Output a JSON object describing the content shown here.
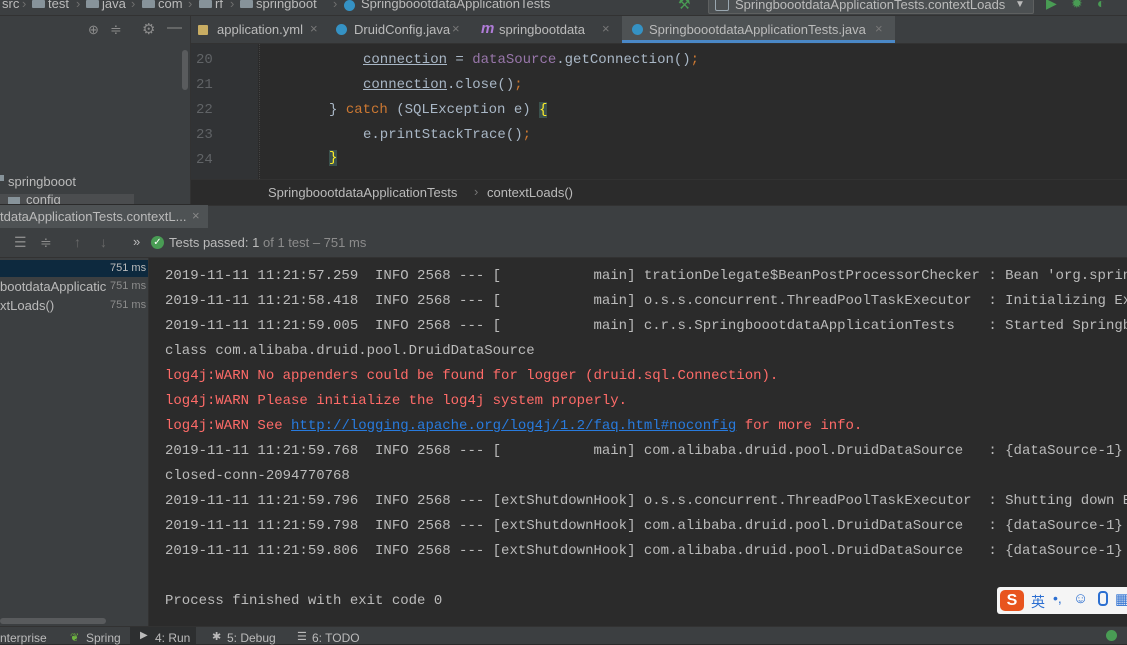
{
  "breadcrumb": [
    "src",
    "test",
    "java",
    "com",
    "rf",
    "springboot",
    "SpringboootdataApplicationTests"
  ],
  "run_config": {
    "label": "SpringboootdataApplicationTests.contextLoads"
  },
  "editor_tabs": [
    {
      "label": "application.yml",
      "active": false
    },
    {
      "label": "DruidConfig.java",
      "active": false
    },
    {
      "label": "springbootdata",
      "active": false
    },
    {
      "label": "SpringboootdataApplicationTests.java",
      "active": true
    }
  ],
  "project_tree": {
    "item1": "springbooot",
    "item2": "config"
  },
  "code": {
    "line_numbers": [
      "20",
      "21",
      "22",
      "23",
      "24"
    ],
    "l20_a": "connection",
    "l20_b": " = ",
    "l20_c": "dataSource",
    "l20_d": ".getConnection()",
    "l20_e": ";",
    "l21_a": "connection",
    "l21_b": ".close()",
    "l21_c": ";",
    "l22_a": "} ",
    "l22_b": "catch",
    "l22_c": " (SQLException e) ",
    "l22_d": "{",
    "l23_a": "e.printStackTrace()",
    "l23_b": ";",
    "l24_a": "}"
  },
  "editor_breadcrumb": {
    "class_name": "SpringboootdataApplicationTests",
    "method": "contextLoads()"
  },
  "run_tab": {
    "label": "tdataApplicationTests.contextL..."
  },
  "test_status": {
    "prefix": "Tests passed:",
    "count": "1",
    "suffix": "of 1 test – 751 ms"
  },
  "test_tree": [
    {
      "label": "",
      "time": "751 ms"
    },
    {
      "label": "bootdataApplicatic",
      "time": "751 ms"
    },
    {
      "label": "xtLoads()",
      "time": "751 ms"
    }
  ],
  "console": {
    "lines": [
      {
        "text": "2019-11-11 11:21:57.259  INFO 2568 --- [           main] trationDelegate$BeanPostProcessorChecker : Bean 'org.springfram",
        "type": "info"
      },
      {
        "text": "2019-11-11 11:21:58.418  INFO 2568 --- [           main] o.s.s.concurrent.ThreadPoolTaskExecutor  : Initializing Executo",
        "type": "info"
      },
      {
        "text": "2019-11-11 11:21:59.005  INFO 2568 --- [           main] c.r.s.SpringboootdataApplicationTests    : Started Springboootd",
        "type": "info"
      },
      {
        "text": "class com.alibaba.druid.pool.DruidDataSource",
        "type": "info"
      },
      {
        "text": "log4j:WARN No appenders could be found for logger (druid.sql.Connection).",
        "type": "warn"
      },
      {
        "text": "log4j:WARN Please initialize the log4j system properly.",
        "type": "warn"
      },
      {
        "text": "2019-11-11 11:21:59.768  INFO 2568 --- [           main] com.alibaba.druid.pool.DruidDataSource   : {dataSource-1} inite",
        "type": "info"
      },
      {
        "text": "closed-conn-2094770768",
        "type": "info"
      },
      {
        "text": "2019-11-11 11:21:59.796  INFO 2568 --- [extShutdownHook] o.s.s.concurrent.ThreadPoolTaskExecutor  : Shutting down Execut",
        "type": "info"
      },
      {
        "text": "2019-11-11 11:21:59.798  INFO 2568 --- [extShutdownHook] com.alibaba.druid.pool.DruidDataSource   : {dataSource-1} closi",
        "type": "info"
      },
      {
        "text": "2019-11-11 11:21:59.806  INFO 2568 --- [extShutdownHook] com.alibaba.druid.pool.DruidDataSource   : {dataSource-1} closed",
        "type": "info"
      }
    ],
    "warn_link": {
      "prefix": "log4j:WARN See ",
      "url": "http://logging.apache.org/log4j/1.2/faq.html#noconfig",
      "suffix": " for more info."
    },
    "exit": "Process finished with exit code 0"
  },
  "bottom_tabs": [
    {
      "label": "nterprise"
    },
    {
      "label": "Spring"
    },
    {
      "label": "4: Run",
      "active": true
    },
    {
      "label": "5: Debug"
    },
    {
      "label": "6: TODO"
    }
  ],
  "ime": {
    "label": "英"
  },
  "colors": {
    "accent": "#4a88c7",
    "warn": "#ff6b68",
    "link": "#287bde",
    "pass": "#499c54"
  }
}
